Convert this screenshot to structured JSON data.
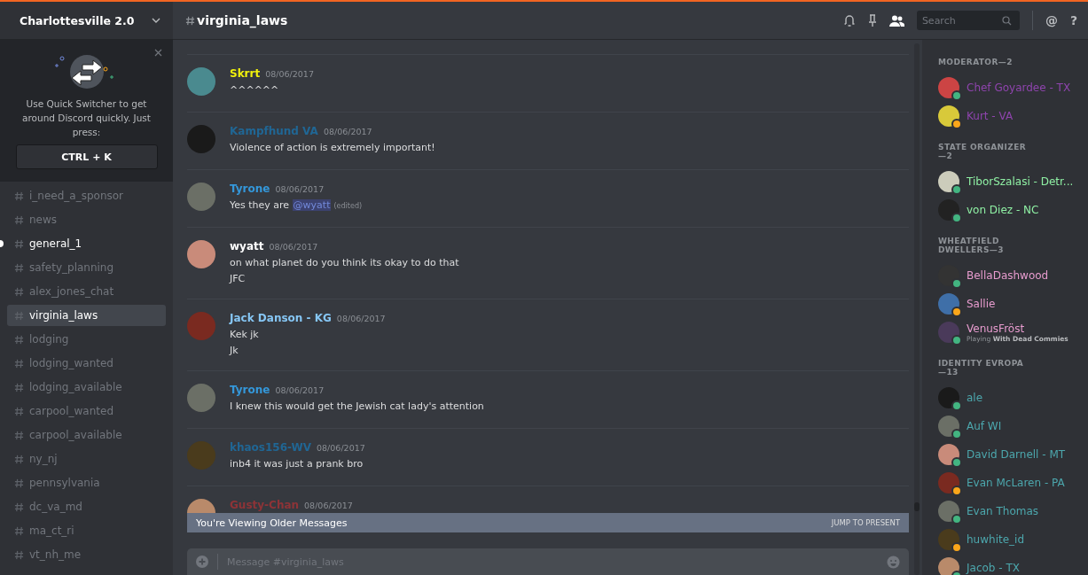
{
  "server": {
    "name": "Charlottesville 2.0"
  },
  "quick_switcher": {
    "text": "Use Quick Switcher to get around Discord quickly. Just press:",
    "shortcut": "CTRL + K"
  },
  "channels": [
    {
      "name": "i_need_a_sponsor",
      "selected": false,
      "unread": false
    },
    {
      "name": "news",
      "selected": false,
      "unread": false
    },
    {
      "name": "general_1",
      "selected": false,
      "unread": true
    },
    {
      "name": "safety_planning",
      "selected": false,
      "unread": false
    },
    {
      "name": "alex_jones_chat",
      "selected": false,
      "unread": false
    },
    {
      "name": "virginia_laws",
      "selected": true,
      "unread": false
    },
    {
      "name": "lodging",
      "selected": false,
      "unread": false
    },
    {
      "name": "lodging_wanted",
      "selected": false,
      "unread": false
    },
    {
      "name": "lodging_available",
      "selected": false,
      "unread": false
    },
    {
      "name": "carpool_wanted",
      "selected": false,
      "unread": false
    },
    {
      "name": "carpool_available",
      "selected": false,
      "unread": false
    },
    {
      "name": "ny_nj",
      "selected": false,
      "unread": false
    },
    {
      "name": "pennsylvania",
      "selected": false,
      "unread": false
    },
    {
      "name": "dc_va_md",
      "selected": false,
      "unread": false
    },
    {
      "name": "ma_ct_ri",
      "selected": false,
      "unread": false
    },
    {
      "name": "vt_nh_me",
      "selected": false,
      "unread": false
    }
  ],
  "header": {
    "channel": "virginia_laws",
    "search_placeholder": "Search",
    "mentions_label": "@",
    "help_label": "?"
  },
  "messages": [
    {
      "author": "Skrrt",
      "color": "#f1f10c",
      "time": "08/06/2017",
      "lines": [
        "^^^^^^"
      ]
    },
    {
      "author": "Kampfhund VA",
      "color": "#206694",
      "time": "08/06/2017",
      "lines": [
        "Violence of action is extremely important!"
      ]
    },
    {
      "author": "Tyrone",
      "color": "#3498db",
      "time": "08/06/2017",
      "lines": [
        "Yes they are "
      ],
      "mention": "@wyatt",
      "edited": "(edited)"
    },
    {
      "author": "wyatt",
      "color": "#ffffff",
      "time": "08/06/2017",
      "lines": [
        "on what planet do you think its okay to do that",
        "JFC"
      ]
    },
    {
      "author": "Jack Danson - KG",
      "color": "#86c6f4",
      "time": "08/06/2017",
      "lines": [
        "Kek jk",
        "Jk"
      ]
    },
    {
      "author": "Tyrone",
      "color": "#3498db",
      "time": "08/06/2017",
      "lines": [
        "I knew this would get the Jewish cat lady's attention"
      ]
    },
    {
      "author": "khaos156-WV",
      "color": "#206694",
      "time": "08/06/2017",
      "lines": [
        "inb4 it was just a prank bro"
      ]
    },
    {
      "author": "Gusty-Chan",
      "color": "#8e3337",
      "time": "08/06/2017"
    }
  ],
  "older_banner": {
    "text": "You're Viewing Older Messages",
    "action": "JUMP TO PRESENT"
  },
  "composer": {
    "placeholder": "Message #virginia_laws"
  },
  "member_groups": [
    {
      "title": "MODERATOR—2",
      "members": [
        {
          "name": "Chef Goyardee - TX",
          "color": "#8e44ad",
          "idle": false
        },
        {
          "name": "Kurt - VA",
          "color": "#8e44ad",
          "idle": true
        }
      ]
    },
    {
      "title": "STATE ORGANIZER—2",
      "members": [
        {
          "name": "TiborSzalasi - Detr...",
          "color": "#8ff0a4",
          "idle": false
        },
        {
          "name": "von Diez - NC",
          "color": "#8ff0a4",
          "idle": false
        }
      ]
    },
    {
      "title": "WHEATFIELD DWELLERS—3",
      "members": [
        {
          "name": "BellaDashwood",
          "color": "#e89ccf",
          "idle": false
        },
        {
          "name": "Sallie",
          "color": "#e89ccf",
          "idle": true
        },
        {
          "name": "VenusFröst",
          "color": "#e89ccf",
          "idle": false,
          "activity": "Playing **With Dead Commies**"
        }
      ]
    },
    {
      "title": "IDENTITY EVROPA—13",
      "members": [
        {
          "name": "ale",
          "color": "#4ca7ad",
          "idle": false
        },
        {
          "name": "Auf WI",
          "color": "#4ca7ad",
          "idle": false
        },
        {
          "name": "David Darnell - MT",
          "color": "#4ca7ad",
          "idle": false
        },
        {
          "name": "Evan McLaren - PA",
          "color": "#4ca7ad",
          "idle": true
        },
        {
          "name": "Evan Thomas",
          "color": "#4ca7ad",
          "idle": false
        },
        {
          "name": "huwhite_id",
          "color": "#4ca7ad",
          "idle": true
        },
        {
          "name": "Jacob - TX",
          "color": "#4ca7ad",
          "idle": false
        }
      ]
    }
  ]
}
